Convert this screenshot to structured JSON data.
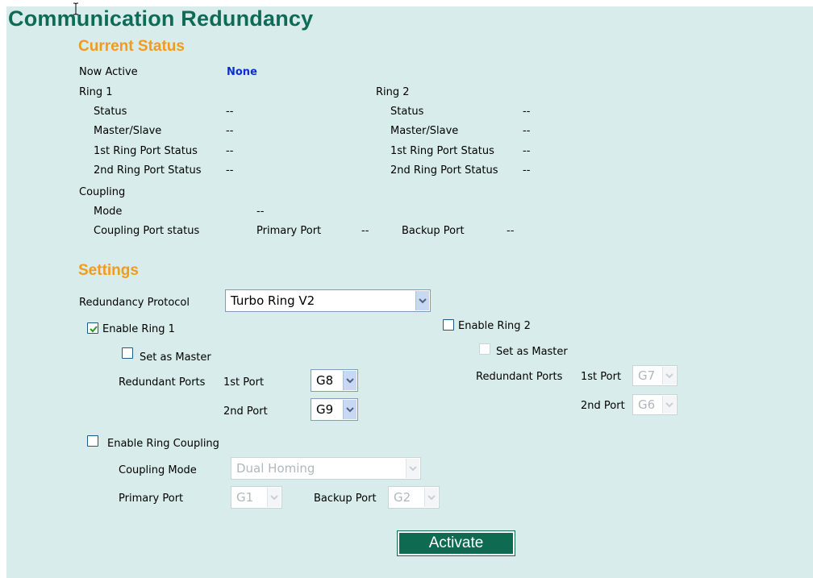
{
  "title": "Communication Redundancy",
  "current_status": {
    "heading": "Current Status",
    "now_active_label": "Now Active",
    "now_active_value": "None",
    "ring1": {
      "label": "Ring 1",
      "rows": [
        {
          "label": "Status",
          "value": "--"
        },
        {
          "label": "Master/Slave",
          "value": "--"
        },
        {
          "label": "1st Ring Port Status",
          "value": "--"
        },
        {
          "label": "2nd Ring Port Status",
          "value": "--"
        }
      ]
    },
    "ring2": {
      "label": "Ring 2",
      "rows": [
        {
          "label": "Status",
          "value": "--"
        },
        {
          "label": "Master/Slave",
          "value": "--"
        },
        {
          "label": "1st Ring Port Status",
          "value": "--"
        },
        {
          "label": "2nd Ring Port Status",
          "value": "--"
        }
      ]
    },
    "coupling": {
      "label": "Coupling",
      "mode_label": "Mode",
      "mode_value": "--",
      "port_status_label": "Coupling Port status",
      "primary_label": "Primary Port",
      "primary_value": "--",
      "backup_label": "Backup Port",
      "backup_value": "--"
    }
  },
  "settings": {
    "heading": "Settings",
    "protocol_label": "Redundancy Protocol",
    "protocol_value": "Turbo Ring V2",
    "ring1": {
      "enable_label": "Enable Ring 1",
      "enabled": true,
      "master_label": "Set as Master",
      "master_checked": false,
      "ports_label": "Redundant Ports",
      "first_port_label": "1st Port",
      "first_port_value": "G8",
      "second_port_label": "2nd Port",
      "second_port_value": "G9"
    },
    "ring2": {
      "enable_label": "Enable Ring 2",
      "enabled": false,
      "master_label": "Set as Master",
      "master_checked": false,
      "ports_label": "Redundant Ports",
      "first_port_label": "1st Port",
      "first_port_value": "G7",
      "second_port_label": "2nd Port",
      "second_port_value": "G6"
    },
    "coupling": {
      "enable_label": "Enable Ring Coupling",
      "enabled": false,
      "mode_label": "Coupling Mode",
      "mode_value": "Dual Homing",
      "primary_label": "Primary Port",
      "primary_value": "G1",
      "backup_label": "Backup Port",
      "backup_value": "G2"
    }
  },
  "activate_label": "Activate",
  "colors": {
    "background": "#d8ecec",
    "title": "#0e6b55",
    "section_heading": "#f39a1c",
    "active_value": "#0a2dd6",
    "button": "#0e6b52"
  }
}
